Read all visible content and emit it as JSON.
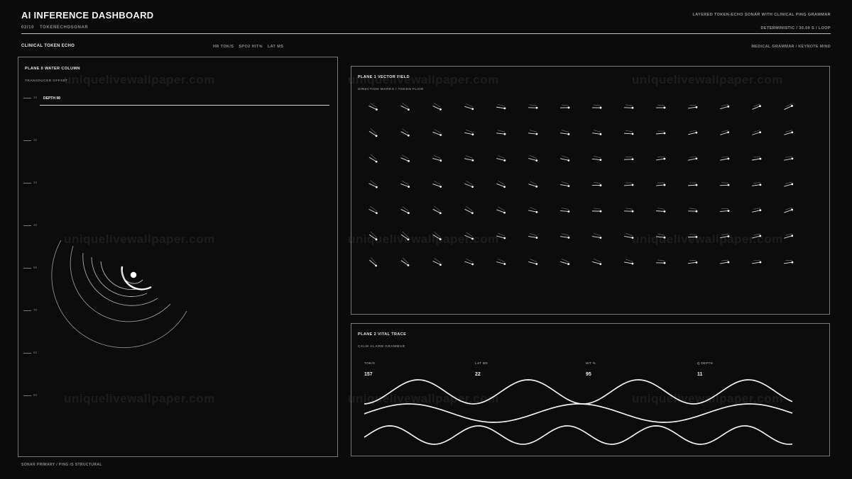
{
  "header": {
    "title": "AI INFERENCE DASHBOARD",
    "tagline": "LAYERED TOKEN-ECHO SONAR WITH CLINICAL PING GRAMMAR",
    "crumb_index": "02/10",
    "crumb_name": "TOKENECHOSONAR",
    "status": "DETERMINISTIC / 30.00 S / LOOP"
  },
  "subheader": {
    "left": "CLINICAL TOKEN ECHO",
    "metrics": [
      "HR TOK/S",
      "SPO2 HIT%",
      "LAT MS"
    ],
    "right": "MEDICAL GRAMMAR / KEYNOTE MIND"
  },
  "plane0": {
    "title": "PLANE 0  WATER COLUMN",
    "subtitle": "TRANSDUCER  OFFSET",
    "depth_label": "DEPTH 98",
    "ticks": [
      "10",
      "22",
      "34",
      "46",
      "58",
      "70",
      "82",
      "94"
    ]
  },
  "plane1": {
    "title": "PLANE 1  VECTOR FIELD",
    "subtitle": "DIRECTION MARKS  /  TOKEN FLOW"
  },
  "plane2": {
    "title": "PLANE 2  VITAL TRACE",
    "subtitle": "CALM ALARM GRAMMAR",
    "vitals": [
      {
        "label": "TOK/S",
        "value": "157"
      },
      {
        "label": "LAT MS",
        "value": "22"
      },
      {
        "label": "HIT %",
        "value": "95"
      },
      {
        "label": "Q DEPTH",
        "value": "11"
      }
    ]
  },
  "footer": {
    "text": "SONAR PRIMARY  /  PING IS STRUCTURAL"
  },
  "watermark": {
    "text": "uniquelivewallpaper.com"
  }
}
